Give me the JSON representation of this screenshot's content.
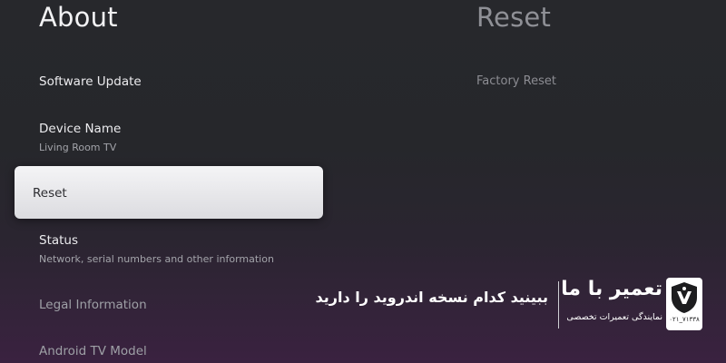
{
  "left_panel": {
    "title": "About",
    "items": [
      {
        "label": "Software Update"
      },
      {
        "label": "Device Name",
        "subtitle": "Living Room TV"
      },
      {
        "label": "Reset"
      },
      {
        "label": "Status",
        "subtitle": "Network, serial numbers and other information"
      },
      {
        "label": "Legal Information"
      },
      {
        "label": "Android TV Model"
      }
    ],
    "selected_item": "Reset"
  },
  "right_panel": {
    "title": "Reset",
    "items": [
      {
        "label": "Factory Reset"
      }
    ]
  },
  "promo": {
    "tagline": "ببینید کدام نسخه اندروید را دارید",
    "brand_name": "تعمیر با ما",
    "brand_tagline": "نمایندگی تعمیرات تخصصی",
    "phone": "۰۲۱_۷۱۳۳۸",
    "logo_icon": "shield-logo-icon"
  },
  "colors": {
    "selected_card": "#e8e8ec",
    "background_top": "#27282c",
    "background_bottom": "#3a2240"
  }
}
